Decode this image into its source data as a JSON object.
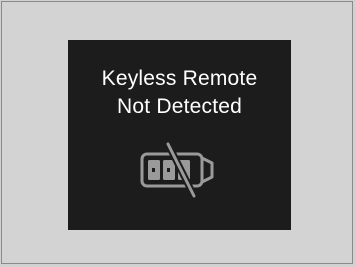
{
  "display": {
    "message_line1": "Keyless Remote",
    "message_line2": "Not Detected",
    "icon": "key-fob-not-detected-icon"
  },
  "colors": {
    "background": "#d3d3d3",
    "screen": "#1c1c1c",
    "text": "#ffffff",
    "icon": "#9a9a9a"
  }
}
